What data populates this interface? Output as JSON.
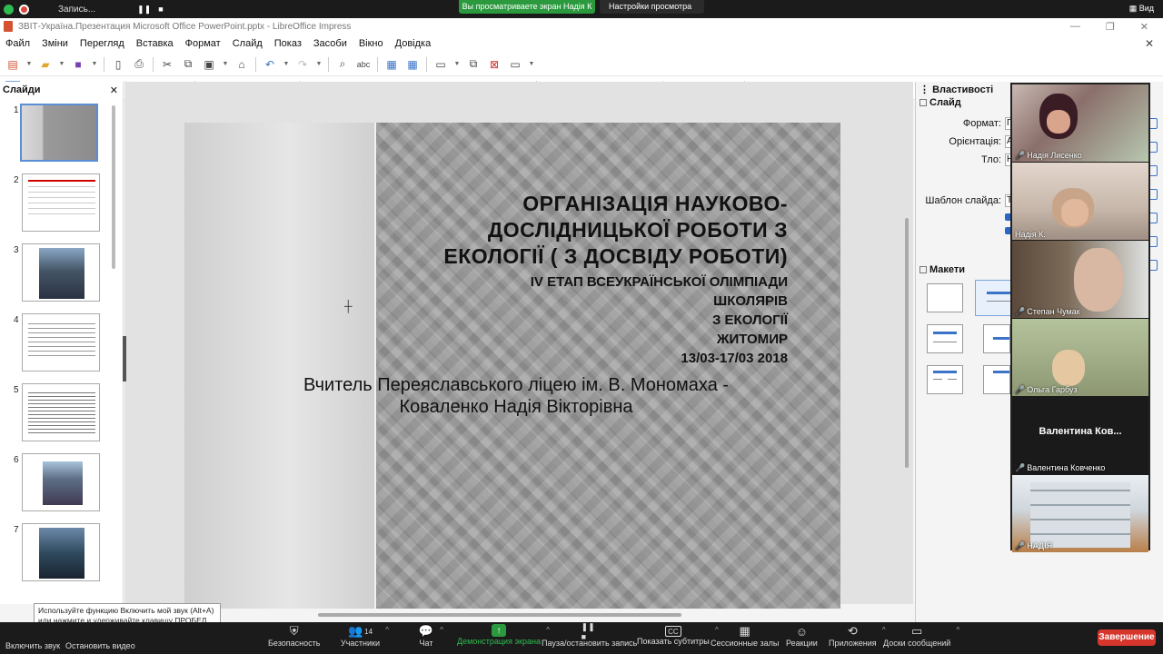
{
  "zoom_top": {
    "recording_label": "Запись...",
    "share_banner": "Вы просматриваете экран Надія К",
    "view_options": "Настройки просмотра",
    "view_button": "Вид"
  },
  "lo": {
    "window_title": "ЗВІТ-Україна.Презентация Microsoft Office PowerPoint.pptx - LibreOffice Impress",
    "menu": [
      "Файл",
      "Зміни",
      "Перегляд",
      "Вставка",
      "Формат",
      "Слайд",
      "Показ",
      "Засоби",
      "Вікно",
      "Довідка"
    ],
    "slide_pane_title": "Слайди",
    "slide_numbers": [
      "1",
      "2",
      "3",
      "4",
      "5",
      "6",
      "7"
    ],
    "slide": {
      "title_lines": [
        "ОРГАНІЗАЦІЯ НАУКОВО-",
        "ДОСЛІДНИЦЬКОЇ РОБОТИ З",
        "ЕКОЛОГІЇ ( З ДОСВІДУ РОБОТИ)"
      ],
      "sub_lines": [
        "IV ЕТАП ВСЕУКРАЇНСЬКОЇ ОЛІМПІАДИ",
        "ШКОЛЯРІВ",
        "З ЕКОЛОГІЇ",
        "ЖИТОМИР",
        "13/03-17/03 2018"
      ],
      "teacher_lines": [
        "Вчитель Переяславського ліцею ім. В. Мономаха -",
        "Коваленко Надія Вікторівна"
      ]
    },
    "properties": {
      "header": "Властивості",
      "section_slide": "Слайд",
      "format_label": "Формат:",
      "format_value": "Г",
      "orientation_label": "Орієнтація:",
      "orientation_value": "А",
      "background_label": "Тло:",
      "background_value": "Н",
      "master_label": "Шаблон слайда:",
      "master_value": "Т",
      "section_layouts": "Макети"
    }
  },
  "participants": [
    {
      "name": "Надія Лисенко"
    },
    {
      "name": "Надія К."
    },
    {
      "name": "Степан Чумак"
    },
    {
      "name": "Ольга Гарбуз"
    },
    {
      "name": "Валентина Ковченко",
      "big_label": "Валентина  Ков..."
    },
    {
      "name": "НАДІЯ"
    }
  ],
  "tooltip": {
    "text": "Используйте функцию Включить мой звук (Alt+A) или нажмите и удерживайте клавишу ПРОБЕЛ, чтобы временно включить звук."
  },
  "zoom_bottom": {
    "unmute": "Включить звук",
    "stop_video": "Остановить видео",
    "security": "Безопасность",
    "participants": "Участники",
    "participant_count": "14",
    "chat": "Чат",
    "share": "Демонстрация экрана",
    "pause_rec": "Пауза/остановить запись",
    "captions": "Показать субтитры",
    "breakout": "Сессионные залы",
    "reactions": "Реакции",
    "apps": "Приложения",
    "whiteboards": "Доски сообщений",
    "end": "Завершение"
  }
}
